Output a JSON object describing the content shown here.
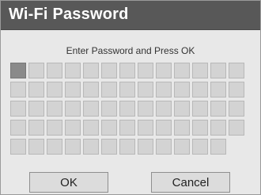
{
  "dialog": {
    "title": "Wi-Fi Password",
    "prompt": "Enter Password and Press OK",
    "ok_label": "OK",
    "cancel_label": "Cancel",
    "grid": {
      "rows": 5,
      "columns": 13,
      "last_row_cells": 12,
      "active_cell_index": 0
    }
  }
}
